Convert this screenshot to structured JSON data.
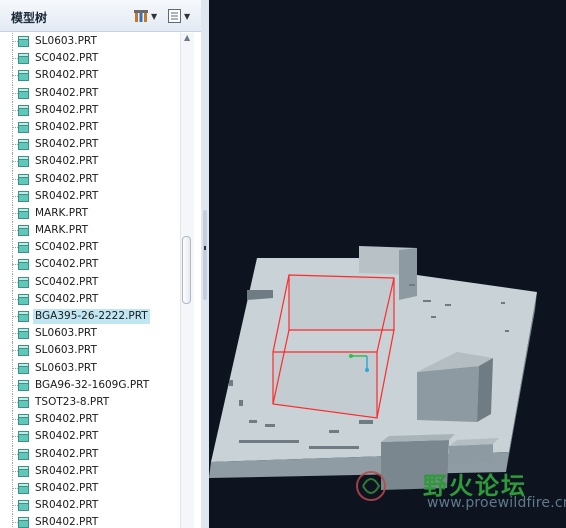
{
  "tree": {
    "title": "模型树",
    "settings_icon": "settings-tool-icon",
    "show_icon": "show-list-icon",
    "items": [
      {
        "label": "SL0603.PRT"
      },
      {
        "label": "SC0402.PRT"
      },
      {
        "label": "SR0402.PRT"
      },
      {
        "label": "SR0402.PRT"
      },
      {
        "label": "SR0402.PRT"
      },
      {
        "label": "SR0402.PRT"
      },
      {
        "label": "SR0402.PRT"
      },
      {
        "label": "SR0402.PRT"
      },
      {
        "label": "SR0402.PRT"
      },
      {
        "label": "SR0402.PRT"
      },
      {
        "label": "MARK.PRT"
      },
      {
        "label": "MARK.PRT"
      },
      {
        "label": "SC0402.PRT"
      },
      {
        "label": "SC0402.PRT"
      },
      {
        "label": "SC0402.PRT"
      },
      {
        "label": "SC0402.PRT"
      },
      {
        "label": "BGA395-26-2222.PRT",
        "selected": true
      },
      {
        "label": "SL0603.PRT"
      },
      {
        "label": "SL0603.PRT"
      },
      {
        "label": "SL0603.PRT"
      },
      {
        "label": "BGA96-32-1609G.PRT"
      },
      {
        "label": "TSOT23-8.PRT"
      },
      {
        "label": "SR0402.PRT"
      },
      {
        "label": "SR0402.PRT"
      },
      {
        "label": "SR0402.PRT"
      },
      {
        "label": "SR0402.PRT"
      },
      {
        "label": "SR0402.PRT"
      },
      {
        "label": "SR0402.PRT"
      },
      {
        "label": "SR0402.PRT"
      }
    ]
  },
  "colors": {
    "viewport_bg": "#0d1420",
    "model_top": "#c9d2d6",
    "model_side": "#98a4aa",
    "model_dark": "#6f7c83",
    "highlight": "#ff2a2a",
    "selection": "#bfe6f2"
  },
  "watermark": {
    "cn": "野火论坛",
    "url": "www.proewildfire.cn"
  }
}
